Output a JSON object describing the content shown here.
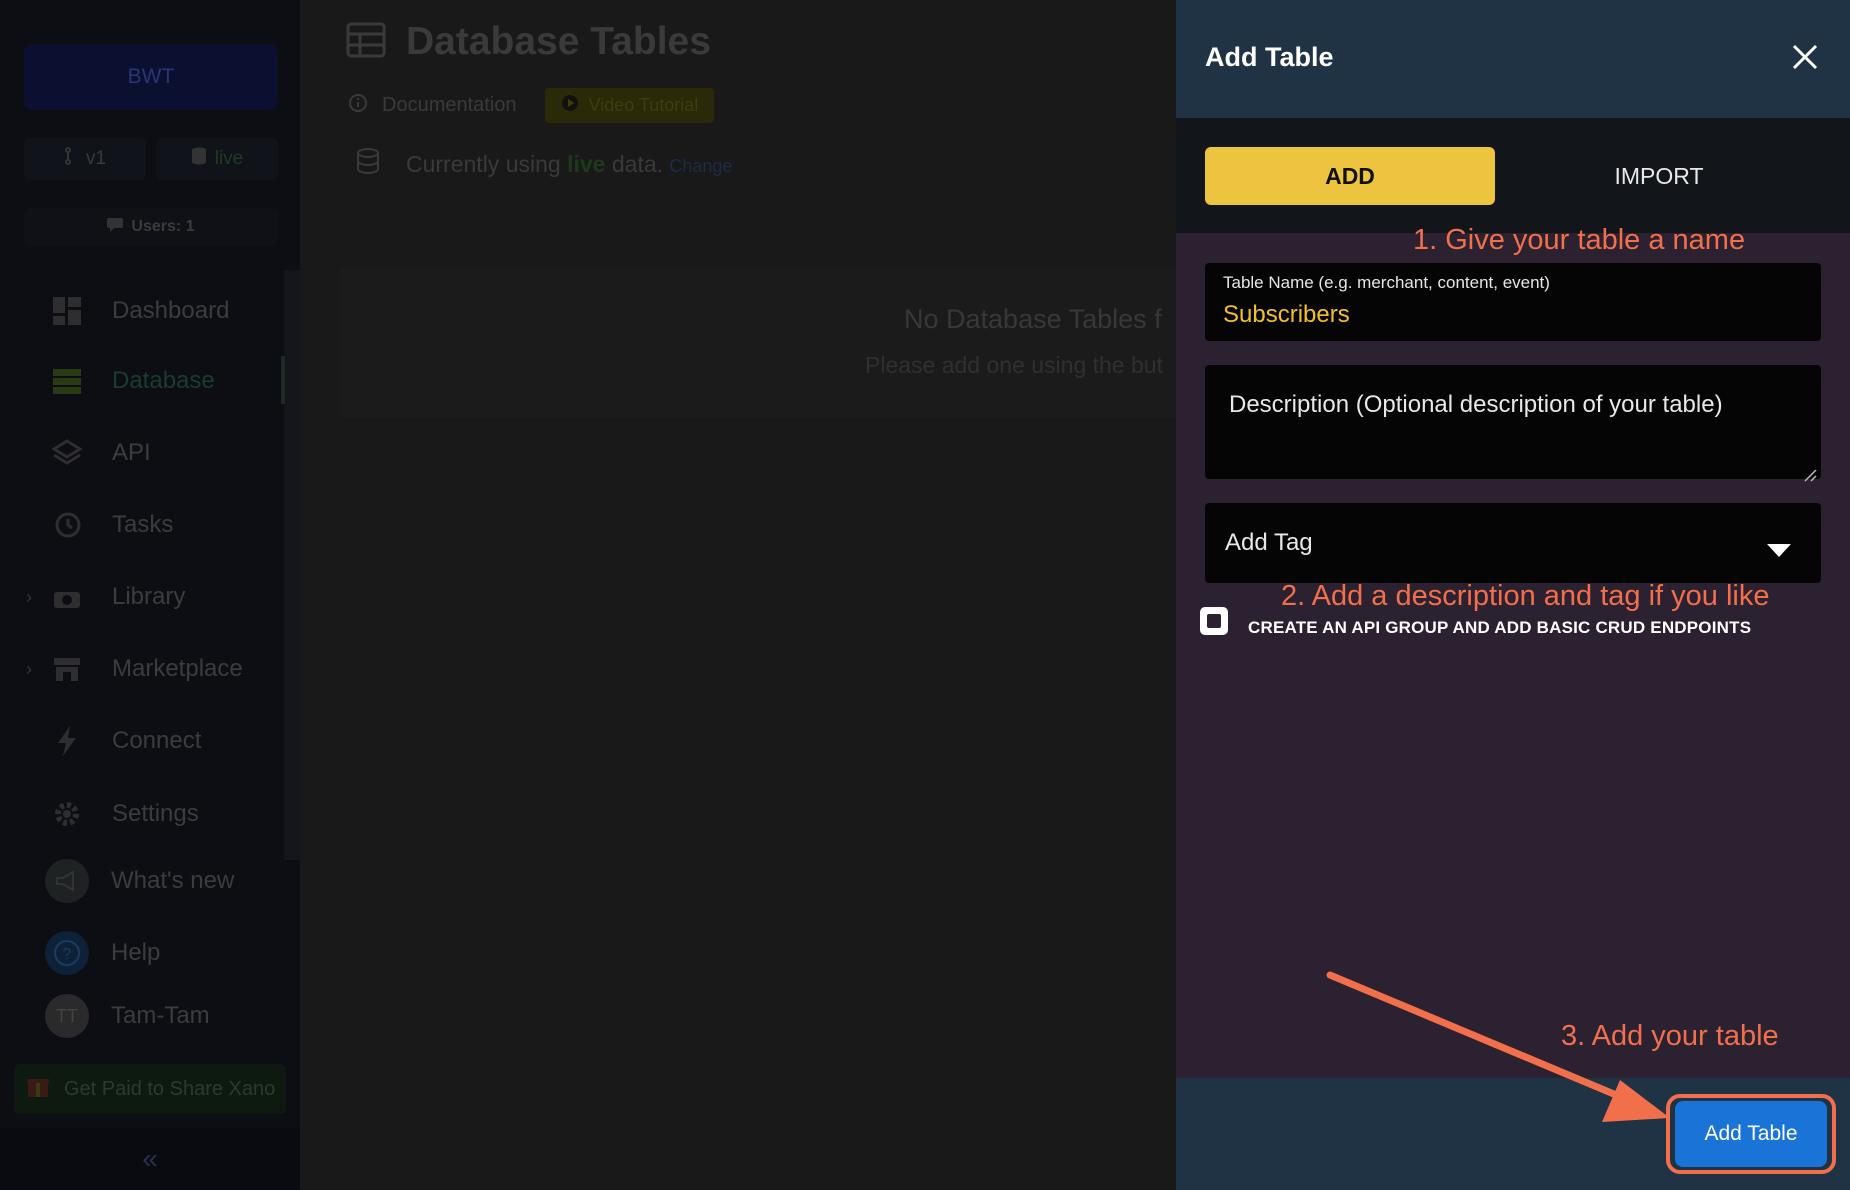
{
  "sidebar": {
    "workspace": "BWT",
    "branch": "v1",
    "data_source": "live",
    "users": "Users: 1",
    "items": [
      {
        "label": "Dashboard",
        "icon": "dashboard-icon"
      },
      {
        "label": "Database",
        "icon": "database-icon"
      },
      {
        "label": "API",
        "icon": "api-icon"
      },
      {
        "label": "Tasks",
        "icon": "tasks-icon"
      },
      {
        "label": "Library",
        "icon": "library-icon"
      },
      {
        "label": "Marketplace",
        "icon": "marketplace-icon"
      },
      {
        "label": "Connect",
        "icon": "connect-icon"
      },
      {
        "label": "Settings",
        "icon": "settings-icon"
      },
      {
        "label": "What's new",
        "icon": "megaphone-icon"
      },
      {
        "label": "Help",
        "icon": "help-icon"
      },
      {
        "label": "Tam-Tam",
        "avatar": "TT"
      }
    ],
    "promo": "Get Paid to Share Xano",
    "collapse": "«"
  },
  "main": {
    "title": "Database Tables",
    "documentation": "Documentation",
    "video_tutorial": "Video Tutorial",
    "using_prefix": "Currently using",
    "using_live": "live",
    "using_suffix": "data.",
    "change": "Change",
    "empty_title": "No Database Tables f",
    "empty_sub": "Please add one using the but"
  },
  "panel": {
    "title": "Add Table",
    "tab_add": "ADD",
    "tab_import": "IMPORT",
    "name_label": "Table Name (e.g. merchant, content, event)",
    "name_value": "Subscribers",
    "description_placeholder": "Description (Optional description of your table)",
    "tag_placeholder": "Add Tag",
    "checkbox_label": "CREATE AN API GROUP AND ADD BASIC CRUD ENDPOINTS",
    "checkbox_checked": false,
    "submit": "Add Table"
  },
  "annotations": {
    "step1": "1. Give your table a name",
    "step2": "2. Add a description and tag if you like",
    "step3": "3. Add your table",
    "color": "#f26f4b"
  }
}
